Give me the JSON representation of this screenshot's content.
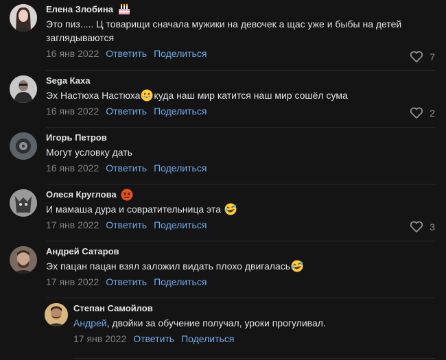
{
  "comments": [
    {
      "author": "Елена Злобина",
      "text": "Это пиз..... Ц товарищи сначала мужики на девочек а щас уже и быбы на детей заглядываются",
      "date": "16 янв 2022",
      "reply_label": "Ответить",
      "share_label": "Поделиться",
      "likes": "7"
    },
    {
      "author": "Sega Каха",
      "text_before": "Эх Настюха Настюха",
      "text_after": "куда наш мир катится наш мир сошёл сума",
      "date": "16 янв 2022",
      "reply_label": "Ответить",
      "share_label": "Поделиться",
      "likes": "2"
    },
    {
      "author": "Игорь Петров",
      "text": "Могут условку дать",
      "date": "16 янв 2022",
      "reply_label": "Ответить",
      "share_label": "Поделиться"
    },
    {
      "author": "Олеся Круглова",
      "text": "И мамаша дура и совратительница эта",
      "date": "17 янв 2022",
      "reply_label": "Ответить",
      "share_label": "Поделиться",
      "likes": "3"
    },
    {
      "author": "Андрей Сатаров",
      "text": "Эх пацан пацан взял заложил видать плохо двигалась",
      "date": "17 янв 2022",
      "reply_label": "Ответить",
      "share_label": "Поделиться"
    },
    {
      "author": "Степан Самойлов",
      "mention": "Андрей",
      "text": ", двойки за обучение получал, уроки прогуливал.",
      "date": "17 янв 2022",
      "reply_label": "Ответить",
      "share_label": "Поделиться"
    }
  ],
  "colors": {
    "background": "#141414",
    "text": "#e1e3e6",
    "link": "#71aaeb",
    "muted": "#828282"
  }
}
